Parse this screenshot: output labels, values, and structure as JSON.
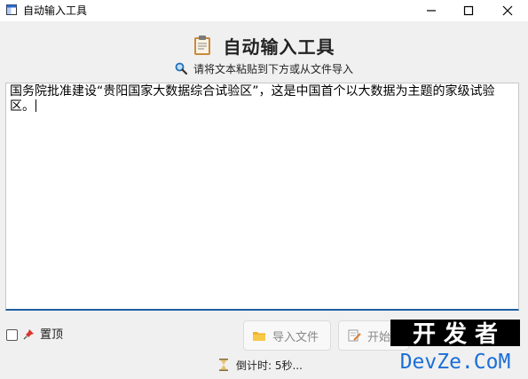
{
  "window": {
    "title": "自动输入工具"
  },
  "header": {
    "title": "自动输入工具",
    "icon": "clipboard-icon"
  },
  "subtitle": {
    "icon": "search-icon",
    "text": "请将文本粘贴到下方或从文件导入"
  },
  "editor": {
    "text": "国务院批准建设“贵阳国家大数据综合试验区”，这是中国首个以大数据为主题的家级试验区。"
  },
  "pin": {
    "checked": false,
    "icon": "pushpin-icon",
    "label": "置顶"
  },
  "buttons": {
    "import_label": "导入文件",
    "import_icon": "folder-icon",
    "start_label": "开始",
    "start_icon": "document-edit-icon"
  },
  "status": {
    "icon": "hourglass-icon",
    "countdown": "倒计时: 5秒..."
  },
  "watermark": {
    "line1": "开 发 者",
    "line2": "DevZe.CoM"
  },
  "colors": {
    "accent_border": "#1e5ea0",
    "folder": "#f0b429",
    "watermark_blue": "#1a6fd6"
  }
}
